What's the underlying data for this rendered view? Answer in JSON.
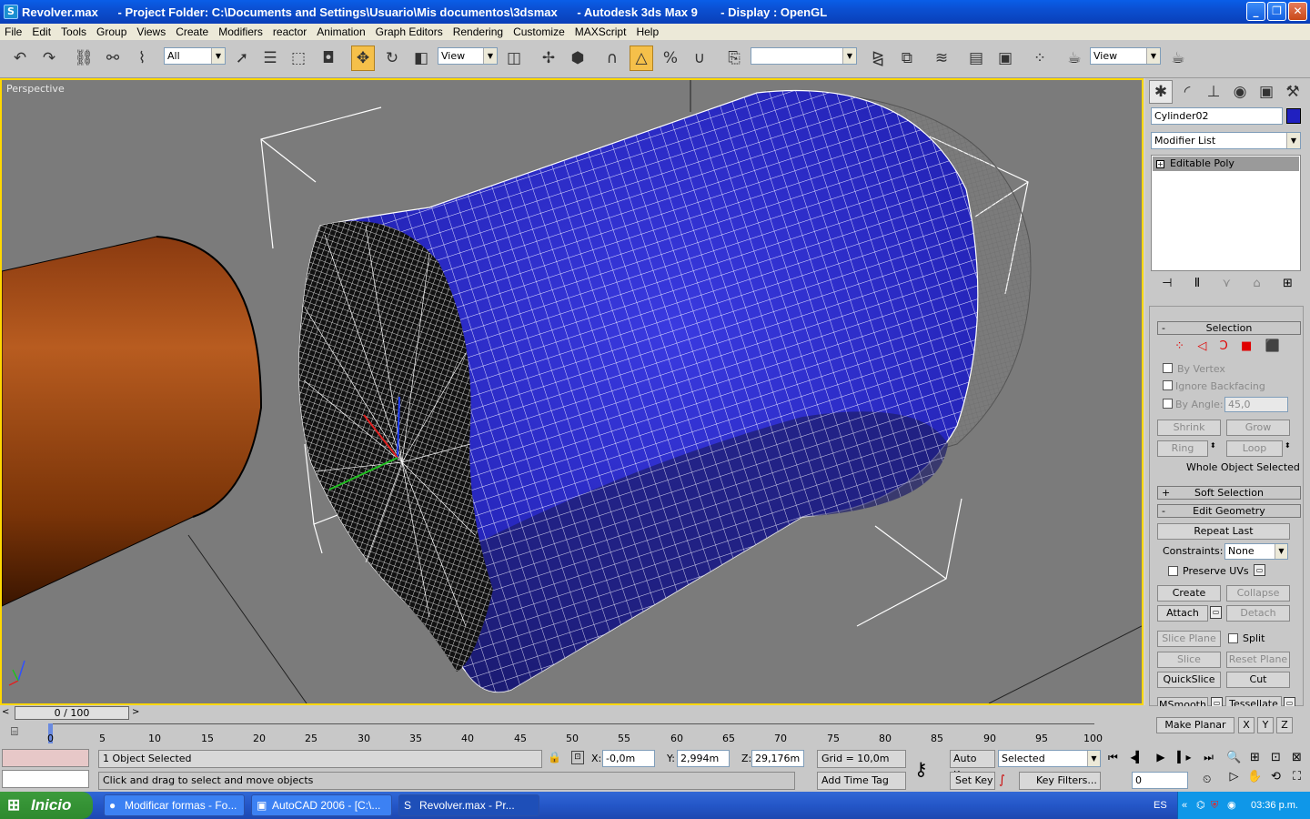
{
  "window": {
    "title": "Revolver.max      - Project Folder: C:\\Documents and Settings\\Usuario\\Mis documentos\\3dsmax      - Autodesk 3ds Max 9       - Display : OpenGL",
    "minimize": "_",
    "maximize": "❐",
    "close": "✕"
  },
  "menu": [
    "File",
    "Edit",
    "Tools",
    "Group",
    "Views",
    "Create",
    "Modifiers",
    "reactor",
    "Animation",
    "Graph Editors",
    "Rendering",
    "Customize",
    "MAXScript",
    "Help"
  ],
  "toolbar": {
    "selection_filter": "All",
    "ref_coord": "View",
    "named_selection": "",
    "render_view": "View"
  },
  "viewport": {
    "label": "Perspective"
  },
  "command_panel": {
    "object_name": "Cylinder02",
    "object_color": "#2020c0",
    "modifier_list": "Modifier List",
    "stack_item": "Editable Poly",
    "selection": {
      "header": "Selection",
      "by_vertex": "By Vertex",
      "ignore_backfacing": "Ignore Backfacing",
      "by_angle": "By Angle:",
      "angle_value": "45,0",
      "shrink": "Shrink",
      "grow": "Grow",
      "ring": "Ring",
      "loop": "Loop",
      "status": "Whole Object Selected"
    },
    "soft_selection": {
      "header": "Soft Selection"
    },
    "edit_geometry": {
      "header": "Edit Geometry",
      "repeat_last": "Repeat Last",
      "constraints_label": "Constraints:",
      "constraints_value": "None",
      "preserve_uvs": "Preserve UVs",
      "create": "Create",
      "collapse": "Collapse",
      "attach": "Attach",
      "detach": "Detach",
      "slice_plane": "Slice Plane",
      "split": "Split",
      "slice": "Slice",
      "reset_plane": "Reset Plane",
      "quickslice": "QuickSlice",
      "cut": "Cut",
      "msmooth": "MSmooth",
      "tessellate": "Tessellate",
      "make_planar": "Make Planar",
      "x": "X",
      "y": "Y",
      "z": "Z"
    }
  },
  "timeline": {
    "slider": "0 / 100",
    "ticks": [
      "0",
      "5",
      "10",
      "15",
      "20",
      "25",
      "30",
      "35",
      "40",
      "45",
      "50",
      "55",
      "60",
      "65",
      "70",
      "75",
      "80",
      "85",
      "90",
      "95",
      "100"
    ]
  },
  "status": {
    "objects_selected": "1 Object Selected",
    "prompt": "Click and drag to select and move objects",
    "x_label": "X:",
    "x_value": "-0,0m",
    "y_label": "Y:",
    "y_value": "2,994m",
    "z_label": "Z:",
    "z_value": "29,176m",
    "grid": "Grid = 10,0m",
    "add_time_tag": "Add Time Tag",
    "auto_key": "Auto Key",
    "set_key": "Set Key",
    "selected": "Selected",
    "key_filters": "Key Filters...",
    "frame": "0"
  },
  "taskbar": {
    "start": "Inicio",
    "items": [
      "Modificar formas - Fo...",
      "AutoCAD 2006 - [C:\\...",
      "Revolver.max      - Pr..."
    ],
    "lang": "ES",
    "clock": "03:36 p.m."
  }
}
